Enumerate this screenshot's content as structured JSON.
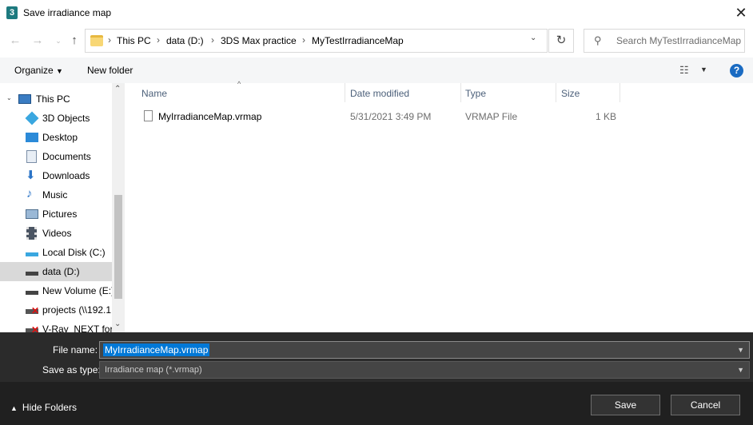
{
  "window": {
    "title": "Save irradiance map",
    "app_icon_glyph": "3"
  },
  "address": {
    "crumbs": [
      "This PC",
      "data (D:)",
      "3DS Max practice",
      "MyTestIrradianceMap"
    ],
    "separator": "›"
  },
  "search": {
    "placeholder": "Search MyTestIrradianceMap"
  },
  "toolbar": {
    "organize": "Organize",
    "new_folder": "New folder"
  },
  "nav": {
    "items": [
      {
        "label": "This PC",
        "icon": "computer-icon"
      },
      {
        "label": "3D Objects",
        "icon": "3d-objects-icon"
      },
      {
        "label": "Desktop",
        "icon": "desktop-icon"
      },
      {
        "label": "Documents",
        "icon": "documents-icon"
      },
      {
        "label": "Downloads",
        "icon": "downloads-icon"
      },
      {
        "label": "Music",
        "icon": "music-icon"
      },
      {
        "label": "Pictures",
        "icon": "pictures-icon"
      },
      {
        "label": "Videos",
        "icon": "videos-icon"
      },
      {
        "label": "Local Disk (C:)",
        "icon": "local-disk-icon"
      },
      {
        "label": "data (D:)",
        "icon": "drive-icon"
      },
      {
        "label": "New Volume (E:)",
        "icon": "drive-icon"
      },
      {
        "label": "projects (\\\\192.1",
        "icon": "network-drive-icon"
      },
      {
        "label": "V-Ray_NEXT for",
        "icon": "network-drive-icon"
      }
    ]
  },
  "columns": {
    "name": "Name",
    "date": "Date modified",
    "type": "Type",
    "size": "Size"
  },
  "files": [
    {
      "name": "MyIrradianceMap.vrmap",
      "date": "5/31/2021 3:49 PM",
      "type": "VRMAP File",
      "size": "1 KB"
    }
  ],
  "form": {
    "file_name_label": "File name:",
    "file_name_value": "MyIrradianceMap.vrmap",
    "save_type_label": "Save as type:",
    "save_type_value": "Irradiance map (*.vrmap)"
  },
  "footer": {
    "hide_folders": "Hide Folders",
    "save": "Save",
    "cancel": "Cancel"
  }
}
